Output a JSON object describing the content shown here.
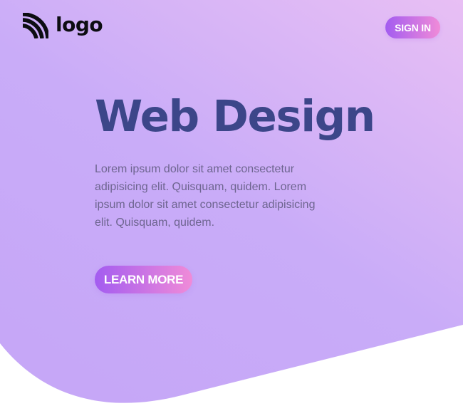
{
  "header": {
    "logo": {
      "icon": "rss-icon",
      "text": "logo"
    },
    "sign_in_label": "SIGN IN"
  },
  "hero": {
    "title": "Web Design",
    "description": "Lorem ipsum dolor sit amet consectetur adipisicing elit. Quisquam, quidem. Lorem ipsum dolor sit amet consectetur adipisicing elit. Quisquam, quidem.",
    "cta_label": "LEARN MORE"
  },
  "colors": {
    "background_gradient": [
      "#e7bcf4",
      "#c7aaf9"
    ],
    "title": "#3c4689",
    "body_text": "#6e6590",
    "button_gradient": [
      "#a35cf0",
      "#f08bd8"
    ],
    "logo": "#0d0d12",
    "page_background": "#ffffff"
  }
}
